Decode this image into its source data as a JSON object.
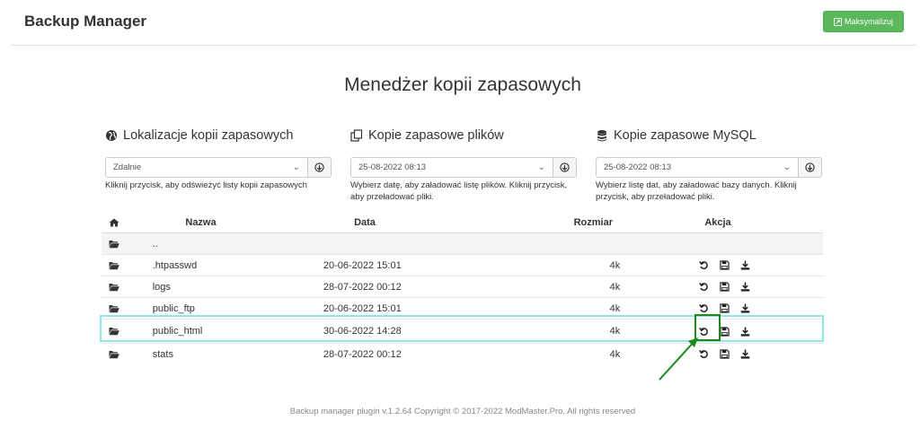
{
  "app": {
    "title": "Backup Manager",
    "maximize_label": "Maksymalizuj"
  },
  "page": {
    "title": "Menedżer kopii zapasowych"
  },
  "panels": [
    {
      "title": "Lokalizacje kopii zapasowych",
      "icon": "globe-icon",
      "selected": "Zdalnie",
      "help": "Kliknij przycisk, aby odświeżyć listy kopii zapasowych"
    },
    {
      "title": "Kopie zapasowe plików",
      "icon": "copy-icon",
      "selected": "25-08-2022 08:13",
      "help": "Wybierz datę, aby załadować listę plików. Kliknij przycisk, aby przeładować pliki."
    },
    {
      "title": "Kopie zapasowe MySQL",
      "icon": "database-icon",
      "selected": "25-08-2022 08:13",
      "help": "Wybierz listę dat, aby załadować bazy danych. Kliknij przycisk, aby przeładować pliki."
    }
  ],
  "table": {
    "headers": {
      "name": "Nazwa",
      "date": "Data",
      "size": "Rozmiar",
      "action": "Akcja"
    },
    "rows": [
      {
        "name": "..",
        "date": "",
        "size": ""
      },
      {
        "name": ".htpasswd",
        "date": "20-06-2022 15:01",
        "size": "4k"
      },
      {
        "name": "logs",
        "date": "28-07-2022 00:12",
        "size": "4k"
      },
      {
        "name": "public_ftp",
        "date": "20-06-2022 15:01",
        "size": "4k"
      },
      {
        "name": "public_html",
        "date": "30-06-2022 14:28",
        "size": "4k"
      },
      {
        "name": "stats",
        "date": "28-07-2022 00:12",
        "size": "4k"
      }
    ]
  },
  "footer": "Backup manager plugin v.1.2.64 Copyright © 2017-2022 ModMaster.Pro. All rights reserved",
  "colors": {
    "accent_green": "#5cb85c",
    "highlight": "#8ee8ee",
    "annotation": "#1a8a1a"
  }
}
